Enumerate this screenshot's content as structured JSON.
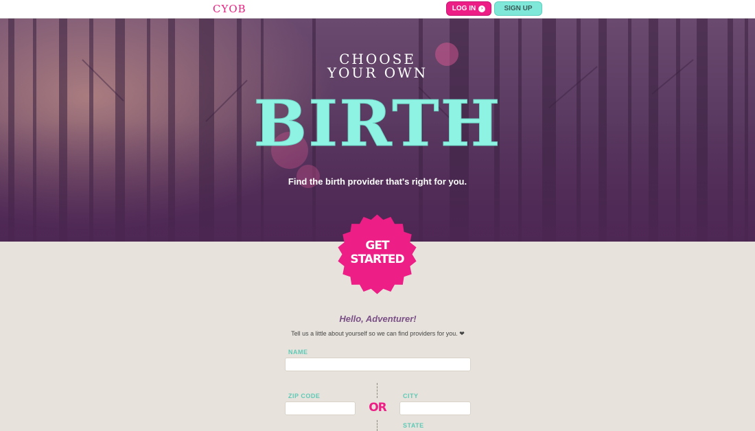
{
  "header": {
    "logo": "CYOB",
    "login_label": "LOG IN",
    "login_arrow": "›",
    "signup_label": "SIGN UP"
  },
  "hero": {
    "tagline_line1": "CHOOSE",
    "tagline_line2": "YOUR OWN",
    "headline": "BIRTH",
    "subtitle": "Find the birth provider that's right for you."
  },
  "cta": {
    "line1": "GET",
    "line2": "STARTED",
    "color": "#ed1e86"
  },
  "form": {
    "title": "Hello, Adventurer!",
    "description": "Tell us a little about yourself so we can find providers for you. ❤",
    "name_label": "NAME",
    "zip_label": "ZIP CODE",
    "or_label": "OR",
    "city_label": "CITY",
    "state_label": "STATE",
    "name_value": "",
    "zip_value": "",
    "city_value": ""
  },
  "colors": {
    "accent_pink": "#ed1e86",
    "accent_mint": "#7fe8d9",
    "hero_purple": "#4c2752"
  }
}
